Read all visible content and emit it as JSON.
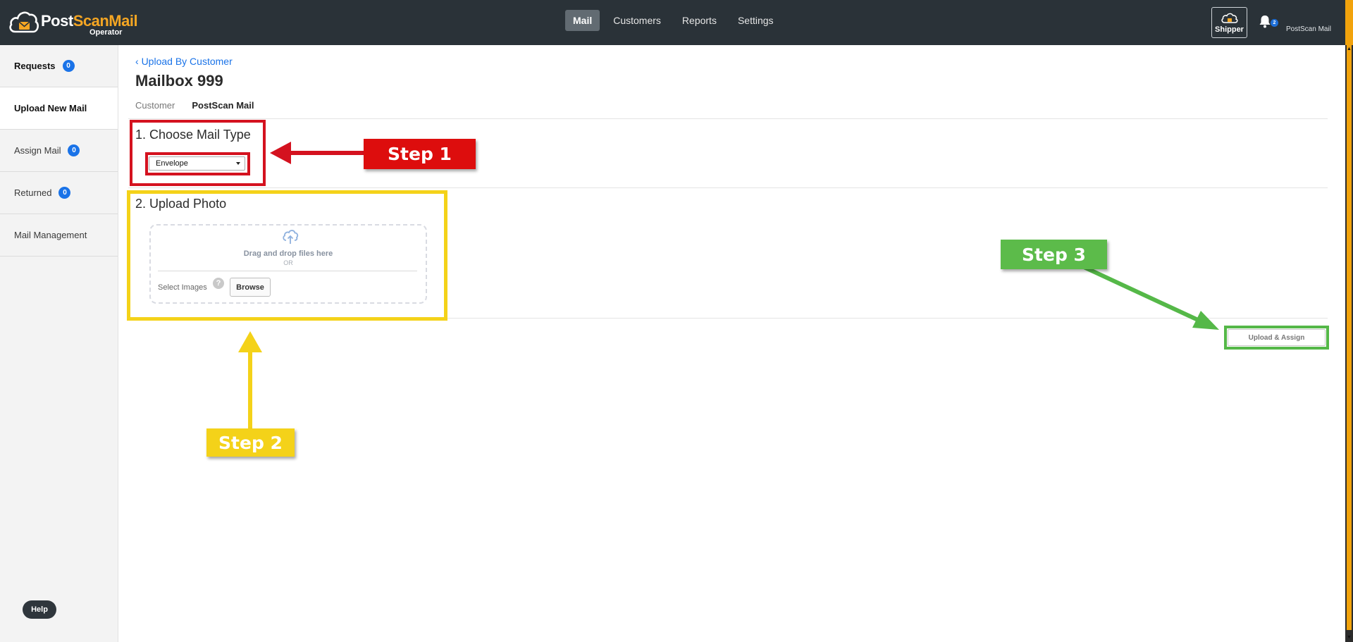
{
  "app": {
    "logo_name_part1": "Post",
    "logo_name_part2": "ScanMail",
    "logo_sub": "Operator"
  },
  "nav": {
    "items": [
      {
        "label": "Mail",
        "active": true
      },
      {
        "label": "Customers",
        "active": false
      },
      {
        "label": "Reports",
        "active": false
      },
      {
        "label": "Settings",
        "active": false
      }
    ],
    "shipper_label": "Shipper",
    "notification_count": "2",
    "account_name": "PostScan Mail"
  },
  "sidebar": {
    "items": [
      {
        "label": "Requests",
        "count": "0"
      },
      {
        "label": "Upload New Mail"
      },
      {
        "label": "Assign Mail",
        "count": "0"
      },
      {
        "label": "Returned",
        "count": "0"
      },
      {
        "label": "Mail Management"
      }
    ],
    "help_label": "Help"
  },
  "main": {
    "back_link": "Upload By Customer",
    "title": "Mailbox 999",
    "tabs": [
      {
        "label": "Customer",
        "active": false
      },
      {
        "label": "PostScan Mail",
        "active": true
      }
    ],
    "section1_title": "1. Choose Mail Type",
    "mail_type_value": "Envelope",
    "section2_title": "2. Upload Photo",
    "dropzone": {
      "text": "Drag and drop files here",
      "or": "OR",
      "select_label": "Select Images",
      "help": "?",
      "browse": "Browse"
    },
    "upload_assign_label": "Upload & Assign"
  },
  "annotations": {
    "step1": "Step 1",
    "step2": "Step 2",
    "step3": "Step 3",
    "colors": {
      "step1": "#dd0d0d",
      "step2": "#f4d219",
      "step3": "#5cbb4a"
    }
  }
}
